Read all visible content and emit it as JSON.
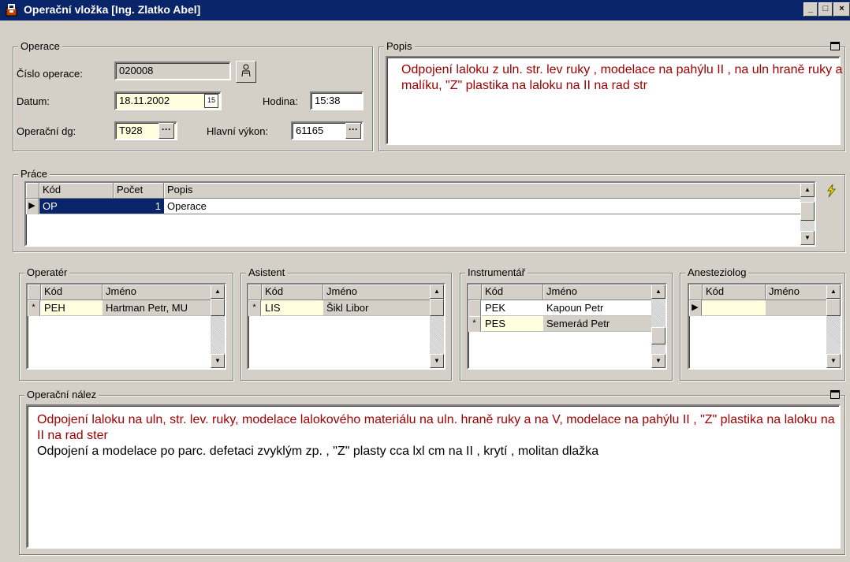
{
  "window": {
    "title": "Operační vložka [Ing. Zlatko Abel]",
    "min": "_",
    "max": "□",
    "close": "×"
  },
  "operace": {
    "legend": "Operace",
    "cislo_label": "Číslo operace:",
    "cislo_value": "020008",
    "datum_label": "Datum:",
    "datum_value": "18.11.2002",
    "cal_text": "15",
    "hodina_label": "Hodina:",
    "hodina_value": "15:38",
    "dg_label": "Operační dg:",
    "dg_value": "T928",
    "vykon_label": "Hlavní výkon:",
    "vykon_value": "61165",
    "ellipsis": "···"
  },
  "popis": {
    "legend": "Popis",
    "text": "Odpojení laloku z uln. str. lev ruky , modelace na pahýlu II , na uln hraně ruky a malíku, \"Z\" plastika na laloku na II na rad str"
  },
  "prace": {
    "legend": "Práce",
    "headers": [
      "Kód",
      "Počet",
      "Popis"
    ],
    "rows": [
      {
        "kod": "OP",
        "pocet": "1",
        "popis": "Operace"
      }
    ]
  },
  "operater": {
    "legend": "Operatér",
    "headers": [
      "Kód",
      "Jméno"
    ],
    "rows": [
      {
        "marker": "*",
        "kod": "PEH",
        "jmeno": "Hartman Petr, MU"
      }
    ]
  },
  "asistent": {
    "legend": "Asistent",
    "headers": [
      "Kód",
      "Jméno"
    ],
    "rows": [
      {
        "marker": "*",
        "kod": "LIS",
        "jmeno": "Šikl Libor"
      }
    ]
  },
  "instrumentar": {
    "legend": "Instrumentář",
    "headers": [
      "Kód",
      "Jméno"
    ],
    "rows": [
      {
        "marker": "",
        "kod": "PEK",
        "jmeno": "Kapoun Petr"
      },
      {
        "marker": "*",
        "kod": "PES",
        "jmeno": "Semerád Petr"
      }
    ]
  },
  "anesteziolog": {
    "legend": "Anesteziolog",
    "headers": [
      "Kód",
      "Jméno"
    ],
    "rows": [
      {
        "marker": "▶",
        "kod": "",
        "jmeno": ""
      }
    ]
  },
  "nalez": {
    "legend": "Operační nález",
    "line_red": "Odpojení laloku na uln, str. lev. ruky, modelace lalokového materiálu na uln. hraně ruky a na V, modelace na pahýlu II , \"Z\" plastika na laloku na II na rad ster",
    "line_black": "Odpojení a modelace po parc. defetaci zvyklým zp. , \"Z\" plasty cca lxl cm na II , krytí , molitan dlažka"
  },
  "colors": {
    "title_bg": "#0a246a",
    "red_text": "#a00000",
    "select_bg": "#0a246a",
    "yellow_field": "#ffffe0"
  }
}
